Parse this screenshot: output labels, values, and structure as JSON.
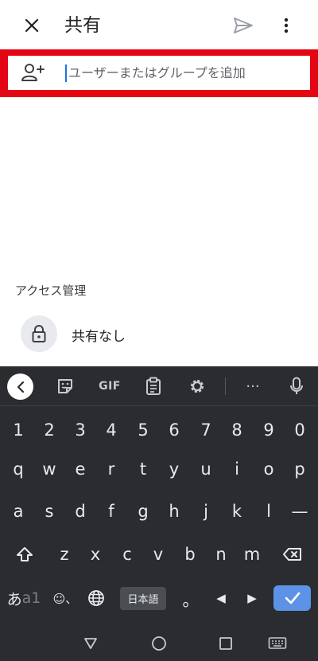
{
  "header": {
    "title": "共有",
    "close_icon": "close-icon",
    "send_icon": "send-icon",
    "more_icon": "more-vert-icon"
  },
  "add_people": {
    "icon": "person-add-icon",
    "placeholder": "ユーザーまたはグループを追加",
    "value": ""
  },
  "access": {
    "label": "アクセス管理",
    "icon": "lock-icon",
    "value": "共有なし"
  },
  "keyboard": {
    "toolbar": {
      "back_icon": "chevron-left-icon",
      "sticker_icon": "sticker-icon",
      "gif_label": "GIF",
      "clipboard_icon": "clipboard-icon",
      "settings_icon": "gear-icon",
      "more_label": "···",
      "mic_icon": "mic-icon"
    },
    "rows": {
      "numbers": [
        "1",
        "2",
        "3",
        "4",
        "5",
        "6",
        "7",
        "8",
        "9",
        "0"
      ],
      "row1": [
        "q",
        "w",
        "e",
        "r",
        "t",
        "y",
        "u",
        "i",
        "o",
        "p"
      ],
      "row2": [
        "a",
        "s",
        "d",
        "f",
        "g",
        "h",
        "j",
        "k",
        "l",
        "—"
      ],
      "row3": [
        "z",
        "x",
        "c",
        "v",
        "b",
        "n",
        "m"
      ]
    },
    "bottom": {
      "lang_toggle_a": "あ",
      "lang_toggle_b": "a1",
      "emoji_label": "☺、",
      "lang_key": "日本語",
      "punct": "。",
      "left_arrow": "◀",
      "right_arrow": "▶"
    },
    "colors": {
      "background": "#2a2c2f",
      "enter": "#5c93e6"
    }
  },
  "nav": {
    "back_icon": "triangle-back-icon",
    "home_icon": "circle-home-icon",
    "recents_icon": "square-recents-icon",
    "keyboard_icon": "keyboard-icon"
  },
  "colors": {
    "highlight": "#e30613",
    "accent": "#1a73e8"
  }
}
